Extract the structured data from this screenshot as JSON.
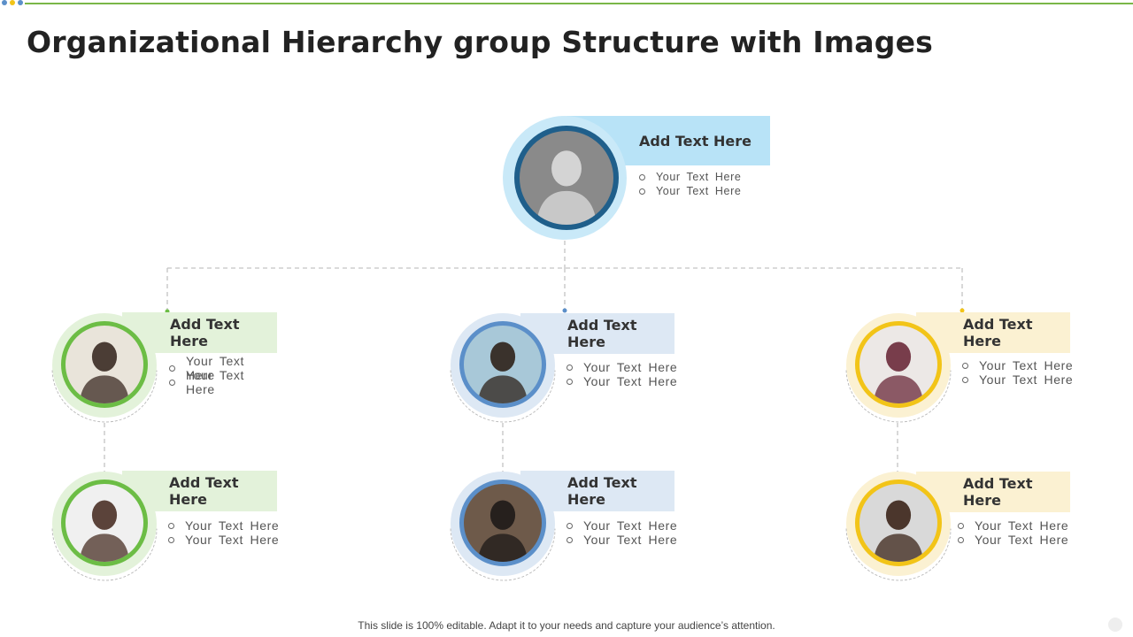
{
  "title": "Organizational Hierarchy group Structure with Images",
  "footer": "This slide is 100% editable. Adapt it to your needs and capture your audience’s attention.",
  "colors": {
    "blue_dark": "#1f5f8b",
    "blue_light": "#b8e3f7",
    "blue_halo": "#c9e9f8",
    "green": "#6cbd45",
    "green_light": "#e3f2da",
    "steel": "#5b8fc9",
    "steel_light": "#dde8f4",
    "yellow": "#f2c418",
    "yellow_light": "#fbf1d2"
  },
  "nodes": {
    "top": {
      "heading": "Add Text Here",
      "bullets": [
        "Your Text Here",
        "Your Text Here"
      ]
    },
    "left1": {
      "heading": "Add Text Here",
      "bullets": [
        "Your Text Here",
        "Your Text Here"
      ]
    },
    "mid1": {
      "heading": "Add Text Here",
      "bullets": [
        "Your Text Here",
        "Your Text Here"
      ]
    },
    "right1": {
      "heading": "Add Text Here",
      "bullets": [
        "Your Text Here",
        "Your Text Here"
      ]
    },
    "left2": {
      "heading": "Add Text Here",
      "bullets": [
        "Your Text Here",
        "Your Text Here"
      ]
    },
    "mid2": {
      "heading": "Add Text Here",
      "bullets": [
        "Your Text Here",
        "Your Text Here"
      ]
    },
    "right2": {
      "heading": "Add Text Here",
      "bullets": [
        "Your Text Here",
        "Your Text Here"
      ]
    }
  }
}
